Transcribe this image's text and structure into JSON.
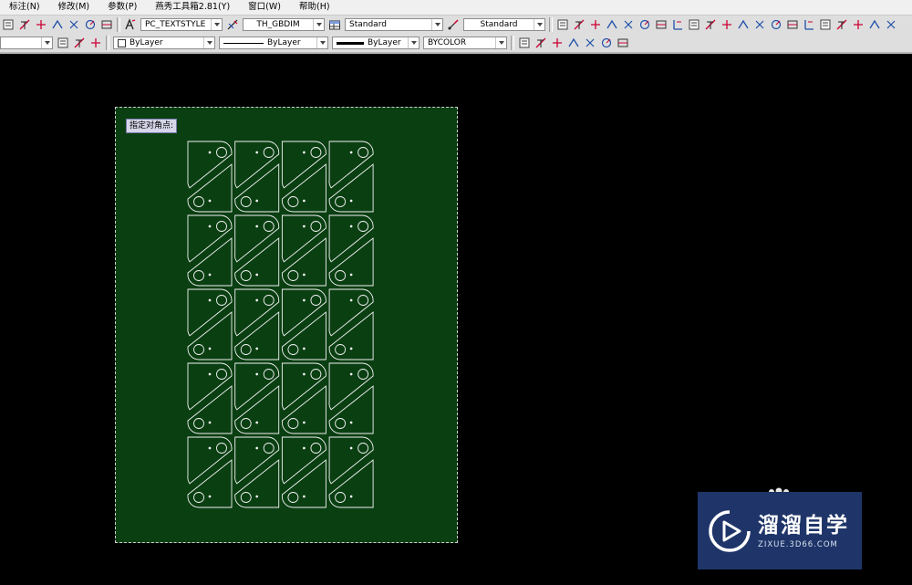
{
  "menu": [
    "标注(N)",
    "修改(M)",
    "参数(P)",
    "燕秀工具箱2.81(Y)",
    "窗口(W)",
    "帮助(H)"
  ],
  "styles": {
    "text_style": "PC_TEXTSTYLE",
    "dim_style": "TH_GBDIM",
    "table_style": "Standard",
    "multileader_style": "Standard"
  },
  "properties": {
    "color": "ByLayer",
    "linetype": "ByLayer",
    "lineweight": "ByLayer",
    "plot_style": "BYCOLOR"
  },
  "command_prompt": "指定对角点:",
  "watermark": {
    "title": "溜溜自学",
    "url": "ZIXUE.3D66.COM"
  },
  "colors": {
    "model_space_background": "#000000",
    "sheet_background": "#0a3f12",
    "drawing_lines": "#f2f2f2",
    "watermark_background": "#1f3569"
  },
  "icons": {
    "toolbar_1_left": [
      "zoom-realtime-icon",
      "new-sheet-icon",
      "sheet-set-icon",
      "tool-palette-icon",
      "markup-icon",
      "quickcalc-icon",
      "help-icon"
    ],
    "dimension_toolbar": [
      "linear-dim-icon",
      "aligned-dim-icon",
      "arc-length-icon",
      "ordinate-dim-icon",
      "radius-dim-icon",
      "jogged-dim-icon",
      "diameter-dim-icon",
      "angular-dim-icon",
      "quick-dim-icon",
      "baseline-dim-icon",
      "continue-dim-icon",
      "dim-space-icon",
      "dim-break-icon",
      "tolerance-icon",
      "center-mark-icon",
      "inspection-icon",
      "jogged-linear-icon",
      "dim-edit-icon",
      "dim-text-edit-icon",
      "dim-update-icon",
      "dim-style-icon"
    ],
    "layer_toolbar": [
      "layer-previous-icon",
      "layer-make-current-icon",
      "layer-states-icon"
    ],
    "view_toolbar": [
      "3d-orbit-icon",
      "free-orbit-icon",
      "continuous-orbit-icon",
      "3d-pan-icon",
      "3d-zoom-icon",
      "view-cube-icon",
      "visual-style-icon"
    ]
  }
}
